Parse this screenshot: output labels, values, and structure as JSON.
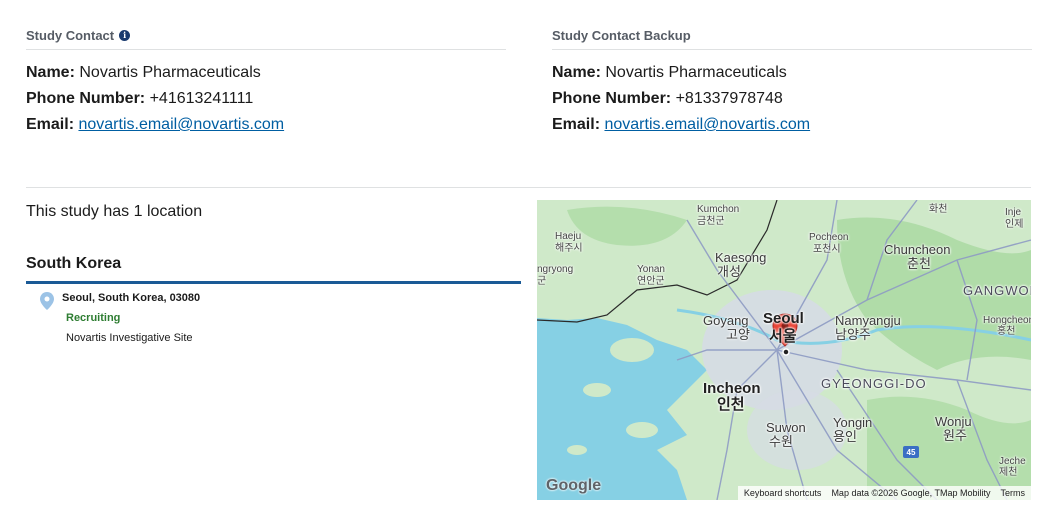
{
  "contacts": {
    "primary": {
      "heading": "Study Contact",
      "name_label": "Name:",
      "name": "Novartis Pharmaceuticals",
      "phone_label": "Phone Number:",
      "phone": "+41613241111",
      "email_label": "Email:",
      "email": "novartis.email@novartis.com"
    },
    "backup": {
      "heading": "Study Contact Backup",
      "name_label": "Name:",
      "name": "Novartis Pharmaceuticals",
      "phone_label": "Phone Number:",
      "phone": "+81337978748",
      "email_label": "Email:",
      "email": "novartis.email@novartis.com"
    }
  },
  "locations": {
    "count_text": "This study has 1 location",
    "country": "South Korea",
    "sites": [
      {
        "address": "Seoul, South Korea, 03080",
        "status": "Recruiting",
        "name": "Novartis Investigative Site"
      }
    ]
  },
  "map": {
    "labels": {
      "kumchon": "Kumchon",
      "kumchon_ko": "금천군",
      "haeju": "Haeju",
      "haeju_ko": "해주시",
      "kaesong": "Kaesong",
      "kaesong_ko": "개성",
      "pocheon": "Pocheon",
      "pocheon_ko": "포천시",
      "chuncheon": "Chuncheon",
      "chuncheon_ko": "춘천",
      "inje": "Inje",
      "inje_ko": "인제",
      "hwacheon_ko": "화천",
      "ongryong": "ngryong",
      "ongryong_ko": "군",
      "yonan": "Yonan",
      "yonan_ko": "연안군",
      "gangwon": "GANGWON-",
      "goyang": "Goyang",
      "goyang_ko": "고양",
      "seoul": "Seoul",
      "seoul_ko": "서울",
      "namyangju": "Namyangju",
      "namyangju_ko": "남양주",
      "hongcheon": "Hongcheon",
      "hongcheon_ko": "홍천",
      "incheon": "Incheon",
      "incheon_ko": "인천",
      "gyeonggi": "GYEONGGI-DO",
      "yongin": "Yongin",
      "yongin_ko": "용인",
      "suwon": "Suwon",
      "suwon_ko": "수원",
      "wonju": "Wonju",
      "wonju_ko": "원주",
      "jeche": "Jeche",
      "jeche_ko": "제천"
    },
    "route_badge": "45",
    "google_logo": "Google",
    "footer": {
      "keyboard": "Keyboard shortcuts",
      "map_data": "Map data ©2026 Google, TMap Mobility",
      "terms": "Terms"
    },
    "colors": {
      "water": "#86d0e4",
      "land": "#cfe9c9",
      "green": "#a8d8a0",
      "urban": "#d6dbe6",
      "road": "#8e9bc4",
      "marker": "#ea4335"
    }
  },
  "colors": {
    "link": "#005ea2",
    "recruiting": "#2e7d32",
    "country_rule": "#1a5a96"
  }
}
